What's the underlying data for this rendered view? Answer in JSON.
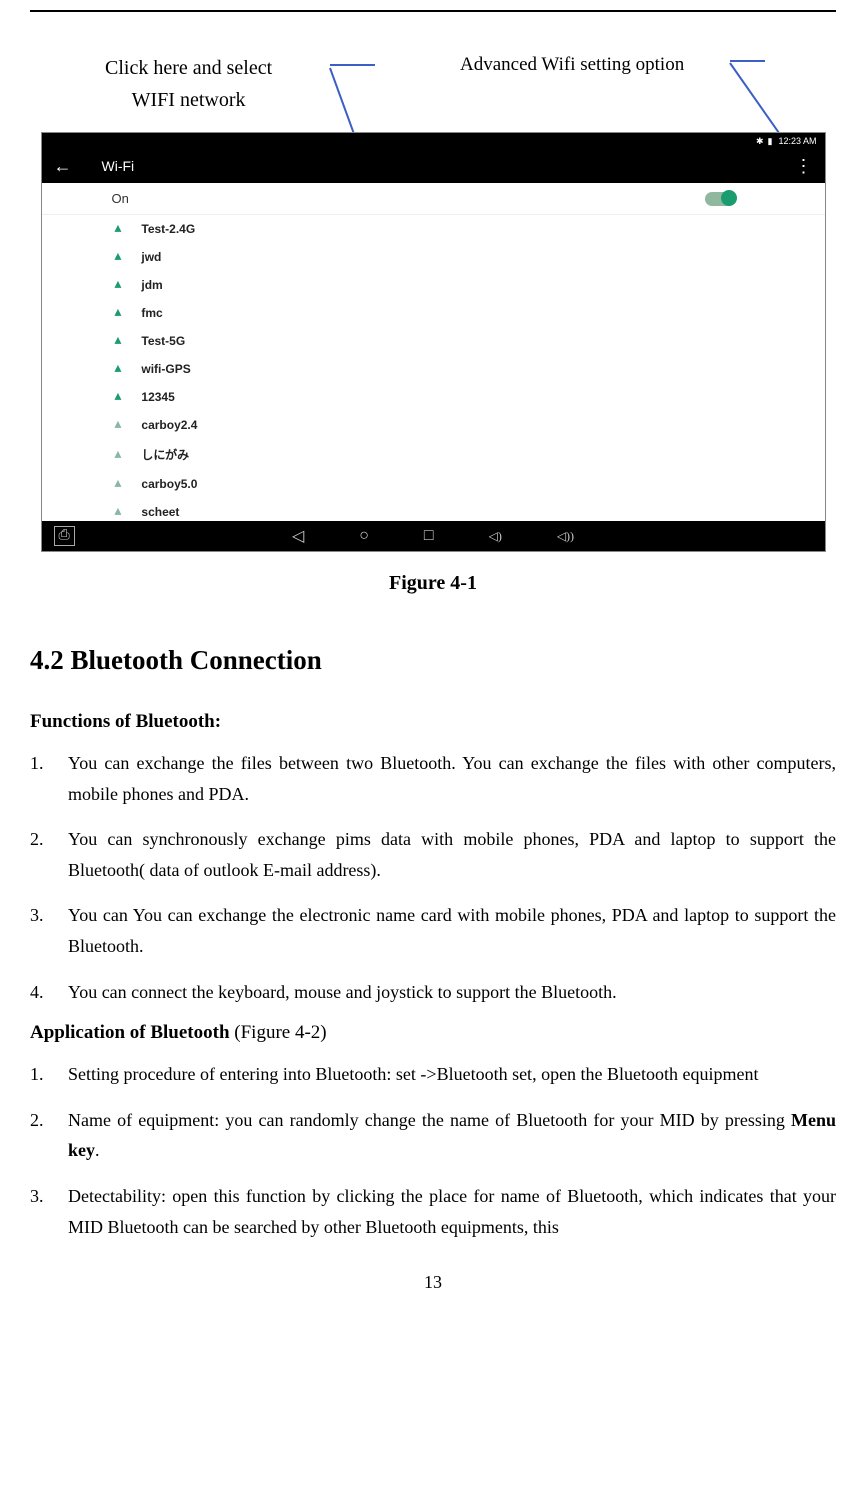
{
  "topRule": true,
  "annotations": {
    "left_line1": "Click here and select",
    "left_line2": "WIFI network",
    "right": "Advanced Wifi setting option"
  },
  "screenshot": {
    "status_time": "12:23 AM",
    "header": {
      "title": "Wi-Fi"
    },
    "toggle_label": "On",
    "wifi_networks": [
      {
        "name": "Test-2.4G",
        "strong": true
      },
      {
        "name": "jwd",
        "strong": true
      },
      {
        "name": "jdm",
        "strong": true
      },
      {
        "name": "fmc",
        "strong": true
      },
      {
        "name": "Test-5G",
        "strong": true
      },
      {
        "name": "wifi-GPS",
        "strong": true
      },
      {
        "name": "12345",
        "strong": true
      },
      {
        "name": "carboy2.4",
        "strong": false
      },
      {
        "name": "しにがみ",
        "strong": false
      },
      {
        "name": "carboy5.0",
        "strong": false
      },
      {
        "name": "scheet",
        "strong": false
      }
    ]
  },
  "figure_caption": "Figure   4-1",
  "section_heading": "4.2  Bluetooth Connection",
  "subheading1": "Functions of Bluetooth:",
  "functions": [
    {
      "num": "1.",
      "text": "You can exchange the files between two Bluetooth. You can exchange    the files with other computers, mobile phones and PDA."
    },
    {
      "num": "2.",
      "text": "You can synchronously exchange pims data with mobile phones, PDA and laptop to support the Bluetooth( data of outlook E-mail address)."
    },
    {
      "num": "3.",
      "text": "You can You can exchange the electronic name card with mobile phones, PDA and laptop to support the Bluetooth."
    },
    {
      "num": "4.",
      "text": "You can connect the keyboard, mouse and joystick to support the Bluetooth."
    }
  ],
  "subheading2_bold": "Application of Bluetooth",
  "subheading2_rest": " (Figure 4-2)",
  "applications": [
    {
      "num": "1.",
      "text": "Setting procedure of entering into Bluetooth: set ->Bluetooth set, open the Bluetooth equipment"
    },
    {
      "num": "2.",
      "text_before": "Name of equipment: you can randomly change the name of Bluetooth for your MID by pressing ",
      "bold": "Menu key",
      "text_after": "."
    },
    {
      "num": "3.",
      "text": "Detectability: open this function by clicking the place for name of Bluetooth, which indicates that your MID Bluetooth can be searched by other Bluetooth equipments, this"
    }
  ],
  "page_number": "13"
}
